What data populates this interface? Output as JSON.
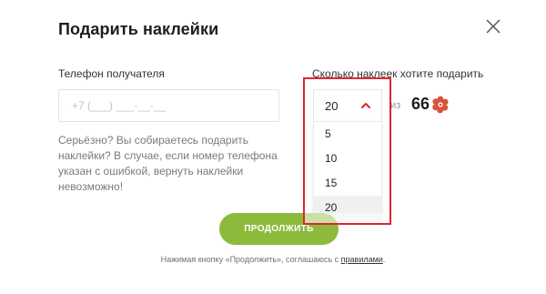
{
  "modal": {
    "title": "Подарить наклейки"
  },
  "phone": {
    "label": "Телефон получателя",
    "placeholder": "+7 (___) ___-__-__",
    "value": ""
  },
  "count": {
    "label": "Сколько наклеек хотите подарить",
    "selected": "20",
    "of_label": "из",
    "total": "66",
    "options": [
      "5",
      "10",
      "15",
      "20"
    ]
  },
  "warning": {
    "text": "Серьёзно? Вы собираетесь подарить наклейки? В случае, если номер телефона указан с ошибкой, вернуть наклейки невозможно!"
  },
  "submit": {
    "label": "ПРОДОЛЖИТЬ"
  },
  "footer": {
    "prefix": "Нажимая кнопку «Продолжить», соглашаюсь с",
    "link": "правилами",
    "suffix": "."
  },
  "colors": {
    "accent": "#8cbb3b",
    "highlight": "#e4232f"
  },
  "icons": {
    "close": "close-icon",
    "chevron": "chevron-up-icon",
    "sticker": "sticker-icon"
  }
}
